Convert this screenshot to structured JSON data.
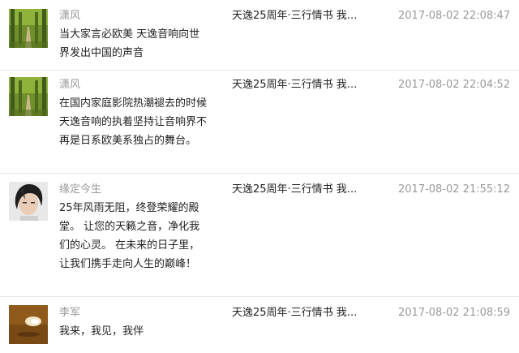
{
  "comments": [
    {
      "avatar": "forest-path-avatar",
      "author": "潇风",
      "content": "当大家言必欧美 天逸音响向世界发出中国的声音",
      "target": "天逸25周年·三行情书 我...",
      "time": "2017-08-02 22:08:47"
    },
    {
      "avatar": "forest-path-avatar",
      "author": "潇风",
      "content": "在国内家庭影院热潮褪去的时候 天逸音响的执着坚持让音响界不再是日系欧美系独占的舞台。",
      "target": "天逸25周年·三行情书 我...",
      "time": "2017-08-02 22:04:52"
    },
    {
      "avatar": "young-man-avatar",
      "author": "缘定今生",
      "content": "25年风雨无阻，终登荣耀的殿堂。 让您的天籁之音，净化我们的心灵。 在未来的日子里，让我们携手走向人生的巅峰！",
      "target": "天逸25周年·三行情书 我...",
      "time": "2017-08-02 21:55:12"
    },
    {
      "avatar": "brown-light-avatar",
      "author": "李军",
      "content": "我来，我见，我伴",
      "target": "天逸25周年·三行情书 我...",
      "time": "2017-08-02 21:08:59"
    }
  ]
}
